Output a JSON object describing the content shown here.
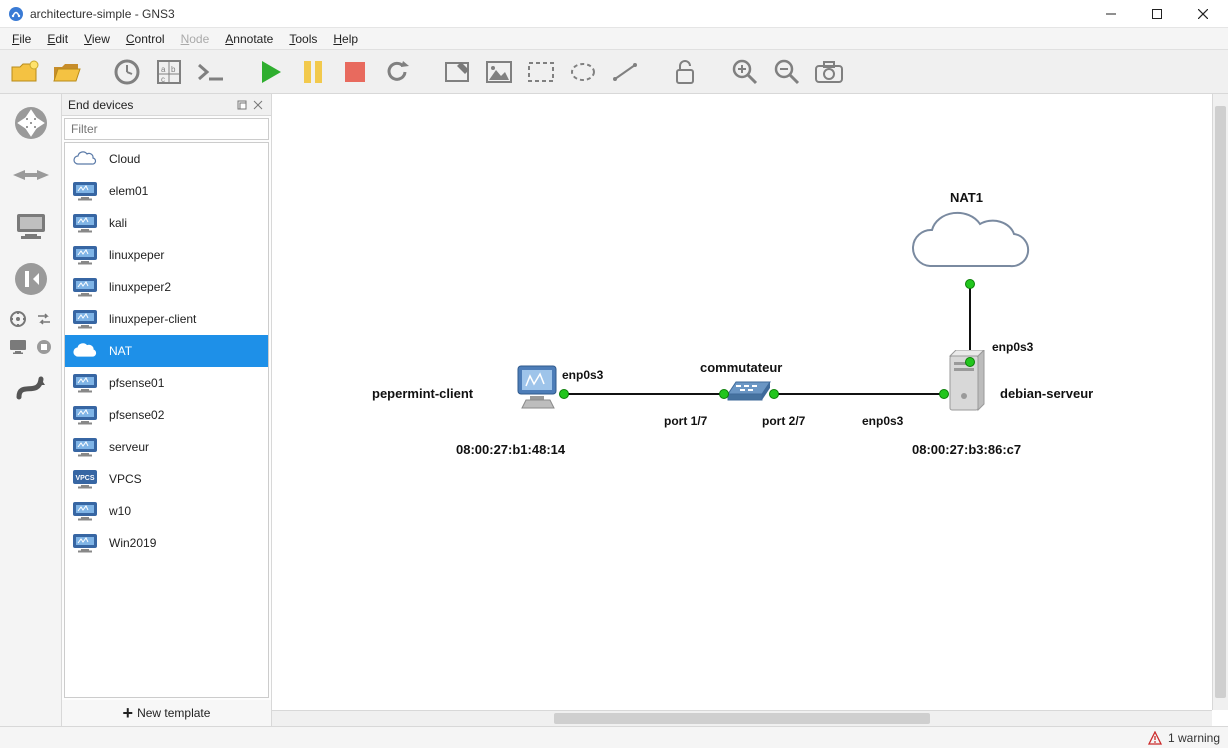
{
  "window": {
    "title": "architecture-simple - GNS3"
  },
  "menubar": {
    "items": [
      "File",
      "Edit",
      "View",
      "Control",
      "Node",
      "Annotate",
      "Tools",
      "Help"
    ],
    "disabled_index": 4
  },
  "toolbar_icons": [
    "new-project",
    "open-project",
    "clock",
    "snap-grid",
    "console",
    "play",
    "pause",
    "stop",
    "reload",
    "draw-rect",
    "draw-image",
    "draw-rect-dash",
    "draw-ellipse",
    "draw-line",
    "lock",
    "zoom-in",
    "zoom-out",
    "screenshot"
  ],
  "left_tools": {
    "big": [
      "routers",
      "switches",
      "end-devices",
      "security",
      "play-fwd"
    ],
    "mini1": [
      "compass",
      "swap"
    ],
    "mini2": [
      "monitor-small",
      "stop-small"
    ],
    "cable": "add-link"
  },
  "panel": {
    "title": "End devices",
    "filter_placeholder": "Filter",
    "new_template": "New template",
    "devices": [
      {
        "name": "Cloud",
        "icon": "cloud-small",
        "selected": false
      },
      {
        "name": "elem01",
        "icon": "pc",
        "selected": false
      },
      {
        "name": "kali",
        "icon": "pc",
        "selected": false
      },
      {
        "name": "linuxpeper",
        "icon": "pc",
        "selected": false
      },
      {
        "name": "linuxpeper2",
        "icon": "pc",
        "selected": false
      },
      {
        "name": "linuxpeper-client",
        "icon": "pc",
        "selected": false
      },
      {
        "name": "NAT",
        "icon": "cloud-small",
        "selected": true
      },
      {
        "name": "pfsense01",
        "icon": "pc",
        "selected": false
      },
      {
        "name": "pfsense02",
        "icon": "pc",
        "selected": false
      },
      {
        "name": "serveur",
        "icon": "pc",
        "selected": false
      },
      {
        "name": "VPCS",
        "icon": "vpcs",
        "selected": false
      },
      {
        "name": "w10",
        "icon": "pc",
        "selected": false
      },
      {
        "name": "Win2019",
        "icon": "pc",
        "selected": false
      }
    ]
  },
  "topology": {
    "nodes": {
      "client": {
        "label": "pepermint-client",
        "mac": "08:00:27:b1:48:14",
        "port": "enp0s3"
      },
      "switch": {
        "label": "commutateur",
        "port_left": "port 1/7",
        "port_right": "port 2/7"
      },
      "server": {
        "label": "debian-serveur",
        "mac": "08:00:27:b3:86:c7",
        "port_left": "enp0s3",
        "port_top": "enp0s3"
      },
      "cloud": {
        "label": "NAT1"
      }
    }
  },
  "status": {
    "warning_text": "1 warning"
  }
}
